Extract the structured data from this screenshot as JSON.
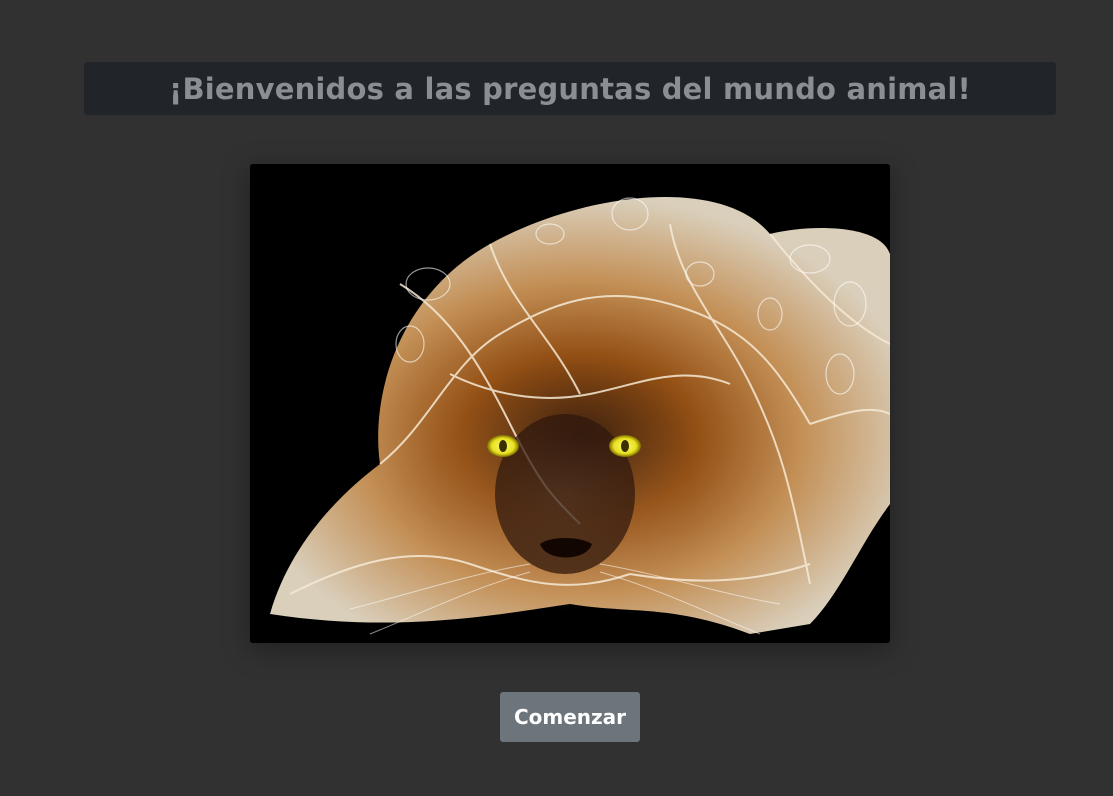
{
  "header": {
    "title": "¡Bienvenidos a las preguntas del mundo animal!"
  },
  "hero": {
    "image": "leopard-fractal-illustration",
    "background": "#000000",
    "eye_color": "#e8e020"
  },
  "actions": {
    "start_label": "Comenzar"
  },
  "colors": {
    "page_background": "#313131",
    "title_bar": "#212428",
    "title_text": "#8a8f96",
    "button": "#6c747c",
    "button_text": "#ffffff"
  }
}
